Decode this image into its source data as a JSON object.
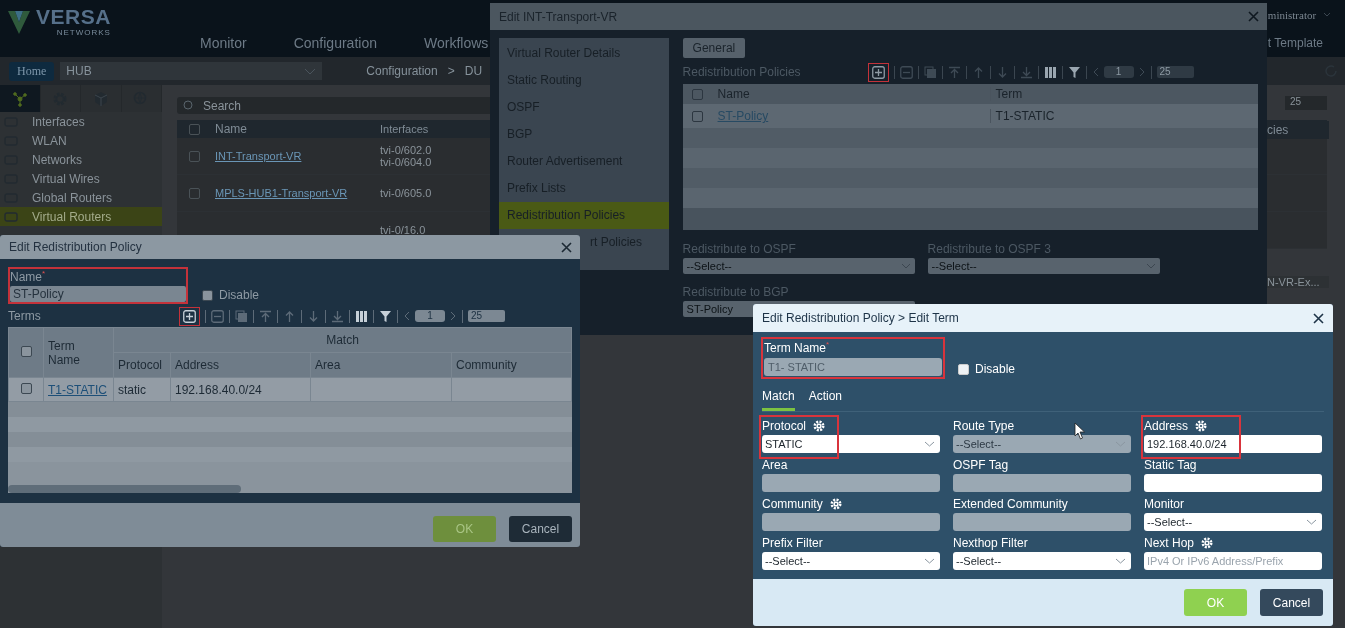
{
  "app": {
    "logo": "VERSA",
    "logo_sub": "NETWORKS",
    "nav": [
      "Monitor",
      "Configuration",
      "Workflows"
    ],
    "user": "ministrator",
    "right_tab": "t Template",
    "home": "Home",
    "org": "HUB",
    "breadcrumb": [
      "Configuration",
      ">",
      "DU"
    ],
    "tabs_selected": [
      true,
      false,
      false,
      false
    ],
    "sidebar": [
      {
        "label": "Interfaces",
        "selected": false
      },
      {
        "label": "WLAN",
        "selected": false
      },
      {
        "label": "Networks",
        "selected": false
      },
      {
        "label": "Virtual Wires",
        "selected": false
      },
      {
        "label": "Global Routers",
        "selected": false
      },
      {
        "label": "Virtual Routers",
        "selected": true
      }
    ],
    "search": {
      "placeholder": "Search"
    },
    "table": {
      "columns": [
        "Name",
        "Interfaces"
      ],
      "all_checked": false,
      "rows": [
        {
          "name": "INT-Transport-VR",
          "interfaces": [
            "tvi-0/602.0",
            "tvi-0/604.0"
          ],
          "checked": false
        },
        {
          "name": "MPLS-HUB1-Transport-VR",
          "interfaces": [
            "tvi-0/605.0"
          ],
          "checked": false
        },
        {
          "interfaces": [
            "tvi-0/16.0"
          ]
        }
      ]
    },
    "right_fragments": {
      "page_size": "25",
      "column": "cies",
      "cell": "N-VR-Ex..."
    }
  },
  "vr_dialog": {
    "title": "Edit INT-Transport-VR",
    "nav": [
      {
        "label": "Virtual Router Details",
        "selected": false
      },
      {
        "label": "Static Routing",
        "selected": false
      },
      {
        "label": "OSPF",
        "selected": false
      },
      {
        "label": "BGP",
        "selected": false
      },
      {
        "label": "Router Advertisement",
        "selected": false
      },
      {
        "label": "Prefix Lists",
        "selected": false
      },
      {
        "label": "Redistribution Policies",
        "selected": true
      },
      {
        "label": "rt Policies",
        "selected": false
      }
    ],
    "tab": {
      "label": "General",
      "selected": true
    },
    "section": "Redistribution Policies",
    "toolbar": {
      "add_highlighted": true,
      "page": "1",
      "page_size": "25"
    },
    "table": {
      "columns": [
        "Name",
        "Term"
      ],
      "all_checked": false,
      "rows": [
        {
          "name": "ST-Policy",
          "term": "T1-STATIC",
          "checked": false
        }
      ]
    },
    "selects": [
      {
        "label": "Redistribute to OSPF",
        "value": "--Select--"
      },
      {
        "label": "Redistribute to OSPF 3",
        "value": "--Select--"
      },
      {
        "label": "Redistribute to BGP",
        "value": "ST-Policy"
      }
    ]
  },
  "policy_dialog": {
    "title": "Edit Redistribution Policy",
    "name_label": "Name$^{*}$",
    "name_value": "ST-Policy",
    "name_highlighted": true,
    "disable": {
      "label": "Disable",
      "checked": false
    },
    "terms_label": "Terms",
    "toolbar": {
      "add_highlighted": true,
      "page": "1",
      "page_size": "25"
    },
    "table": {
      "columns": {
        "term_name": "Term Name",
        "group": "Match",
        "protocol": "Protocol",
        "address": "Address",
        "area": "Area",
        "community": "Community"
      },
      "all_checked": false,
      "rows": [
        {
          "term_name": "T1-STATIC",
          "protocol": "static",
          "address": "192.168.40.0/24",
          "checked": false
        }
      ]
    },
    "buttons": [
      {
        "label": "OK",
        "kind": "primary"
      },
      {
        "label": "Cancel",
        "kind": "secondary"
      }
    ]
  },
  "term_dialog": {
    "title": "Edit Redistribution Policy > Edit Term",
    "name_label": "Term Name$^{*}$",
    "name_value": "T1- STATIC",
    "name_highlighted": true,
    "disable": {
      "label": "Disable",
      "checked": false
    },
    "tabs": [
      {
        "label": "Match",
        "selected": true
      },
      {
        "label": "Action",
        "selected": false
      }
    ],
    "fields": [
      {
        "label": "Protocol",
        "kind": "select",
        "value": "STATIC",
        "disabled": false,
        "gear": true,
        "highlighted": true
      },
      {
        "label": "Route Type",
        "kind": "select",
        "value": "--Select--",
        "disabled": true,
        "gear": false,
        "highlighted": false
      },
      {
        "label": "Address",
        "kind": "input",
        "value": "192.168.40.0/24",
        "disabled": false,
        "gear": true,
        "highlighted": true
      },
      {
        "label": "Area",
        "kind": "input",
        "disabled": true,
        "gear": false,
        "highlighted": false
      },
      {
        "label": "OSPF Tag",
        "kind": "input",
        "disabled": true,
        "gear": false,
        "highlighted": false
      },
      {
        "label": "Static Tag",
        "kind": "input",
        "disabled": false,
        "gear": false,
        "highlighted": false
      },
      {
        "label": "Community",
        "kind": "input",
        "disabled": true,
        "gear": true,
        "highlighted": false
      },
      {
        "label": "Extended Community",
        "kind": "input",
        "disabled": true,
        "gear": false,
        "highlighted": false
      },
      {
        "label": "Monitor",
        "kind": "select",
        "value": "--Select--",
        "disabled": false,
        "gear": false,
        "highlighted": false
      },
      {
        "label": "Prefix Filter",
        "kind": "select",
        "value": "--Select--",
        "disabled": false,
        "gear": false,
        "highlighted": false
      },
      {
        "label": "Nexthop Filter",
        "kind": "select",
        "value": "--Select--",
        "disabled": false,
        "gear": false,
        "highlighted": false
      },
      {
        "label": "Next Hop",
        "kind": "input",
        "placeholder": "IPv4 Or IPv6 Address/Prefix",
        "disabled": false,
        "gear": true,
        "highlighted": false
      }
    ],
    "buttons": [
      {
        "label": "OK",
        "kind": "primary"
      },
      {
        "label": "Cancel",
        "kind": "secondary"
      }
    ]
  }
}
